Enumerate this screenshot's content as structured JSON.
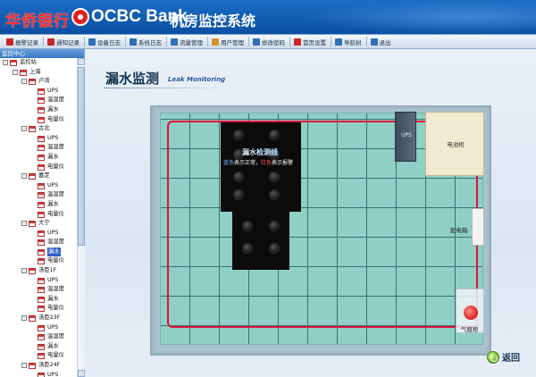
{
  "header": {
    "logo_cn": "华侨银行",
    "logo_en": "OCBC Bank",
    "system_title": "机房监控系统"
  },
  "toolbar": {
    "items": [
      {
        "label": "报警记录",
        "icon": "alarm-icon",
        "color": "#c8282a"
      },
      {
        "label": "通知记录",
        "icon": "notice-icon",
        "color": "#c8282a"
      },
      {
        "label": "设备日志",
        "icon": "device-log-icon",
        "color": "#2f6fb5"
      },
      {
        "label": "系统日志",
        "icon": "system-log-icon",
        "color": "#2f6fb5"
      },
      {
        "label": "流量管理",
        "icon": "flow-icon",
        "color": "#2f6fb5"
      },
      {
        "label": "用户管理",
        "icon": "user-icon",
        "color": "#d7902a"
      },
      {
        "label": "修改密码",
        "icon": "password-icon",
        "color": "#2f6fb5"
      },
      {
        "label": "首页设置",
        "icon": "home-settings-icon",
        "color": "#c8282a"
      },
      {
        "label": "导航树",
        "icon": "nav-tree-icon",
        "color": "#2f6fb5"
      },
      {
        "label": "退出",
        "icon": "exit-icon",
        "color": "#2f6fb5"
      }
    ]
  },
  "left_panel": {
    "title": "监控中心",
    "tree": [
      {
        "label": "监控站",
        "level": 0,
        "toggle": "-"
      },
      {
        "label": "上海",
        "level": 1,
        "toggle": "-"
      },
      {
        "label": "卢湾",
        "level": 2,
        "toggle": "-"
      },
      {
        "label": "UPS",
        "level": 3
      },
      {
        "label": "温湿度",
        "level": 3
      },
      {
        "label": "漏水",
        "level": 3
      },
      {
        "label": "电量仪",
        "level": 3
      },
      {
        "label": "古北",
        "level": 2,
        "toggle": "-"
      },
      {
        "label": "UPS",
        "level": 3
      },
      {
        "label": "温湿度",
        "level": 3
      },
      {
        "label": "漏水",
        "level": 3
      },
      {
        "label": "电量仪",
        "level": 3
      },
      {
        "label": "嘉定",
        "level": 2,
        "toggle": "-"
      },
      {
        "label": "UPS",
        "level": 3
      },
      {
        "label": "温湿度",
        "level": 3
      },
      {
        "label": "漏水",
        "level": 3
      },
      {
        "label": "电量仪",
        "level": 3
      },
      {
        "label": "大宁",
        "level": 2,
        "toggle": "-"
      },
      {
        "label": "UPS",
        "level": 3
      },
      {
        "label": "温湿度",
        "level": 3
      },
      {
        "label": "漏水",
        "level": 3,
        "selected": true
      },
      {
        "label": "电量仪",
        "level": 3
      },
      {
        "label": "汤臣1F",
        "level": 2,
        "toggle": "-"
      },
      {
        "label": "UPS",
        "level": 3
      },
      {
        "label": "温湿度",
        "level": 3
      },
      {
        "label": "漏水",
        "level": 3
      },
      {
        "label": "电量仪",
        "level": 3
      },
      {
        "label": "汤臣23F",
        "level": 2,
        "toggle": "-"
      },
      {
        "label": "UPS",
        "level": 3
      },
      {
        "label": "温湿度",
        "level": 3
      },
      {
        "label": "漏水",
        "level": 3
      },
      {
        "label": "电量仪",
        "level": 3
      },
      {
        "label": "汤臣24F",
        "level": 2,
        "toggle": "-"
      },
      {
        "label": "UPS",
        "level": 3
      }
    ]
  },
  "main": {
    "title": "漏水监测",
    "subtitle": "Leak Monitoring",
    "cabinet_label": "漏水检测线",
    "cabinet_note_blue": "蓝色",
    "cabinet_note_mid": "表示正常，",
    "cabinet_note_red": "红色",
    "cabinet_note_end": "表示报警",
    "ups_label": "UPS",
    "battery_label": "电池柜",
    "power_label": "配电箱",
    "gas_label": "气瓶柜",
    "back_label": "返回"
  },
  "colors": {
    "header_blue": "#0c4fa3",
    "leak_line_red": "#e0123a",
    "floor_teal": "#8fcfc6",
    "selected_item": "#2f62c8"
  }
}
